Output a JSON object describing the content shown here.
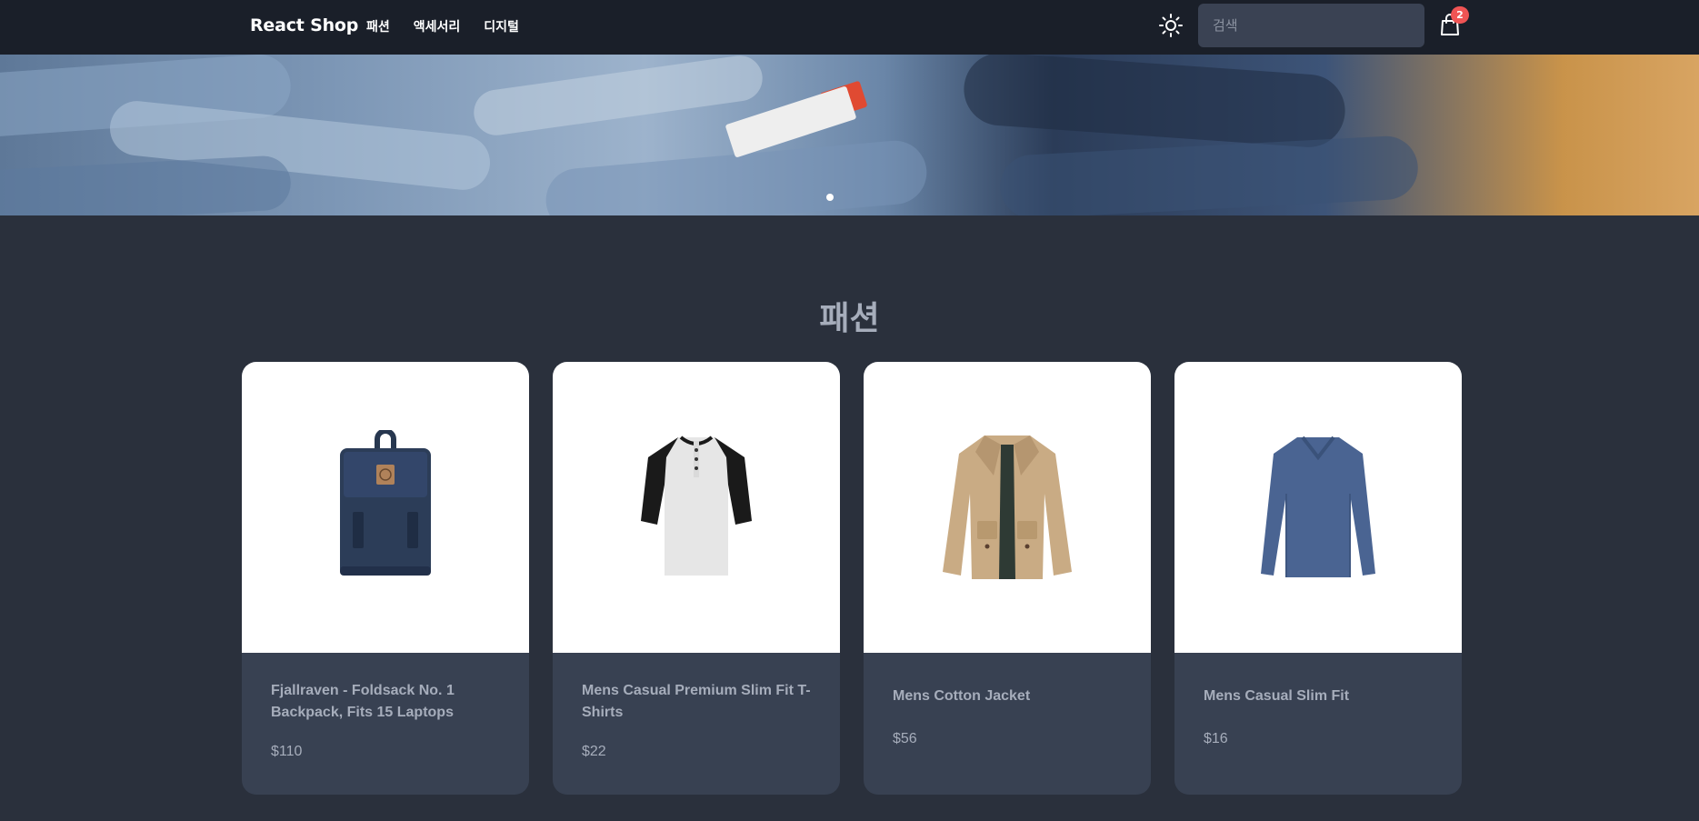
{
  "navbar": {
    "brand": "React Shop",
    "links": [
      "패션",
      "액세서리",
      "디지털"
    ],
    "search_placeholder": "검색",
    "cart_count": "2"
  },
  "hero": {
    "slides": 1
  },
  "section": {
    "title": "패션"
  },
  "products": [
    {
      "title": "Fjallraven - Foldsack No. 1 Backpack, Fits 15 Laptops",
      "price": "$110",
      "icon": "backpack-image"
    },
    {
      "title": "Mens Casual Premium Slim Fit T-Shirts",
      "price": "$22",
      "icon": "tshirt-image"
    },
    {
      "title": "Mens Cotton Jacket",
      "price": "$56",
      "icon": "jacket-image"
    },
    {
      "title": "Mens Casual Slim Fit",
      "price": "$16",
      "icon": "longsleeve-image"
    }
  ],
  "colors": {
    "navbar_bg": "#1a1f29",
    "page_bg": "#2a303c",
    "card_body_bg": "#384152",
    "badge": "#f05454",
    "text_muted": "#a6adbb"
  }
}
